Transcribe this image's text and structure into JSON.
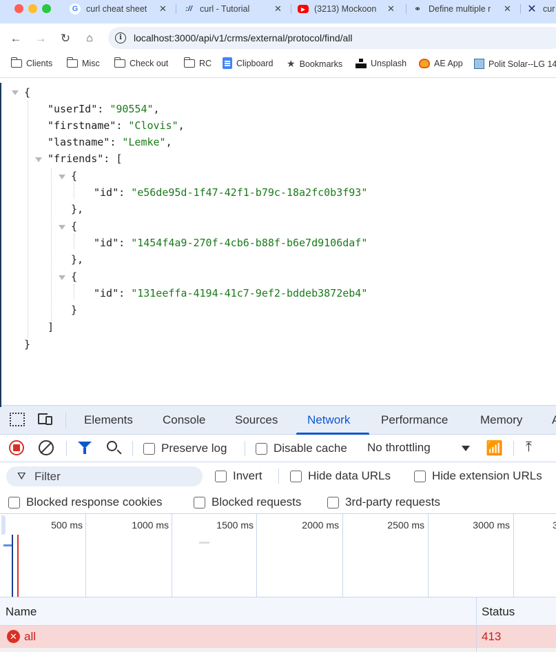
{
  "browser": {
    "tabs": [
      {
        "title": "curl cheat sheet",
        "icon": "google-icon"
      },
      {
        "title": "curl - Tutorial",
        "icon": "tutorial-icon"
      },
      {
        "title": "(3213) Mockoon",
        "icon": "youtube-icon"
      },
      {
        "title": "Define multiple r",
        "icon": "link-icon"
      },
      {
        "title": "cur",
        "icon": "x-logo-icon"
      }
    ],
    "url": "localhost:3000/api/v1/crms/external/protocol/find/all",
    "bookmarks": [
      {
        "label": "Clients",
        "icon": "folder-icon"
      },
      {
        "label": "Misc",
        "icon": "folder-icon"
      },
      {
        "label": "Check out",
        "icon": "folder-icon"
      },
      {
        "label": "RC",
        "icon": "folder-icon"
      },
      {
        "label": "Clipboard",
        "icon": "docs-icon"
      },
      {
        "label": "Bookmarks",
        "icon": "star-icon"
      },
      {
        "label": "Unsplash",
        "icon": "unsplash-icon"
      },
      {
        "label": "AE App",
        "icon": "ae-app-icon"
      },
      {
        "label": "Polit Solar--LG 14",
        "icon": "solar-icon"
      }
    ]
  },
  "json_view": {
    "open_brace": "{",
    "close_brace": "}",
    "userId_key": "\"userId\"",
    "userId_val": "\"90554\"",
    "firstname_key": "\"firstname\"",
    "firstname_val": "\"Clovis\"",
    "lastname_key": "\"lastname\"",
    "lastname_val": "\"Lemke\"",
    "friends_key": "\"friends\"",
    "friends_open": "[",
    "friends_close": "]",
    "id_key": "\"id\"",
    "friends": [
      {
        "id": "\"e56de95d-1f47-42f1-b79c-18a2fc0b3f93\""
      },
      {
        "id": "\"1454f4a9-270f-4cb6-b88f-b6e7d9106daf\""
      },
      {
        "id": "\"131eeffa-4194-41c7-9ef2-bddeb3872eb4\""
      }
    ]
  },
  "devtools": {
    "tabs": [
      "Elements",
      "Console",
      "Sources",
      "Network",
      "Performance",
      "Memory",
      "A"
    ],
    "active_tab": "Network",
    "toolbar": {
      "preserve_log": "Preserve log",
      "disable_cache": "Disable cache",
      "throttling": "No throttling"
    },
    "filter": {
      "placeholder": "Filter",
      "invert": "Invert",
      "hide_data_urls": "Hide data URLs",
      "hide_extension_urls": "Hide extension URLs",
      "blocked_response_cookies": "Blocked response cookies",
      "blocked_requests": "Blocked requests",
      "third_party_requests": "3rd-party requests"
    },
    "timeline_ticks": [
      "500 ms",
      "1000 ms",
      "1500 ms",
      "2000 ms",
      "2500 ms",
      "3000 ms",
      "3"
    ],
    "table": {
      "headers": [
        "Name",
        "Status"
      ],
      "rows": [
        {
          "name": "all",
          "status": "413",
          "error": true
        }
      ]
    },
    "colors": {
      "accent": "#0b57d0",
      "error": "#d93025",
      "error_row_bg": "#f8d7d7"
    }
  }
}
